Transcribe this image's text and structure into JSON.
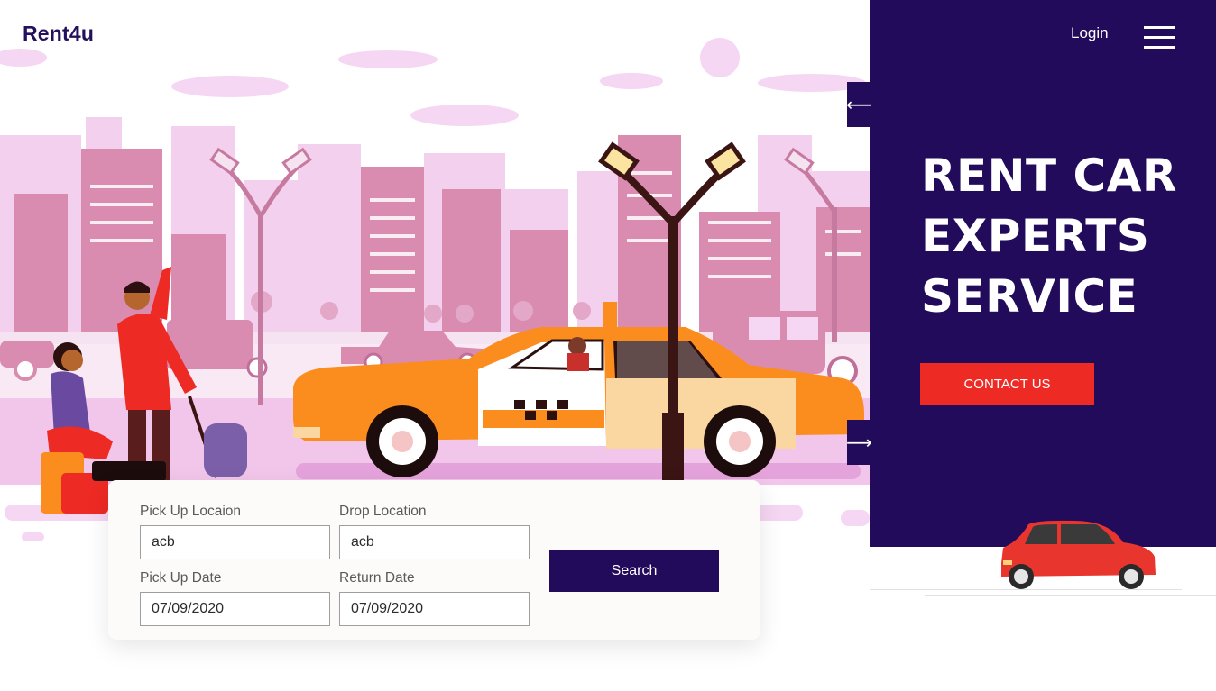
{
  "brand": {
    "name": "Rent4u"
  },
  "nav": {
    "login_label": "Login",
    "menu_icon": "hamburger-icon"
  },
  "hero": {
    "title_lines": [
      "RENT CAR",
      "EXPERTS",
      "SERVICE"
    ],
    "cta_label": "CONTACT US"
  },
  "slider": {
    "prev_icon": "left-arrow-icon",
    "next_icon": "right-arrow-icon",
    "prev_glyph": "⟵",
    "next_glyph": "⟶"
  },
  "search_form": {
    "pickup_location": {
      "label": "Pick Up Locaion",
      "value": "acb"
    },
    "drop_location": {
      "label": "Drop Location",
      "value": "acb"
    },
    "pickup_date": {
      "label": "Pick Up Date",
      "value": "07/09/2020"
    },
    "return_date": {
      "label": "Return Date",
      "value": "07/09/2020"
    },
    "search_label": "Search"
  },
  "colors": {
    "brand_dark": "#220b5b",
    "accent_red": "#ee2a24",
    "taxi_orange": "#fb8c1e",
    "city_pink": "#d98cb0",
    "card_bg": "#fcfbfa"
  }
}
